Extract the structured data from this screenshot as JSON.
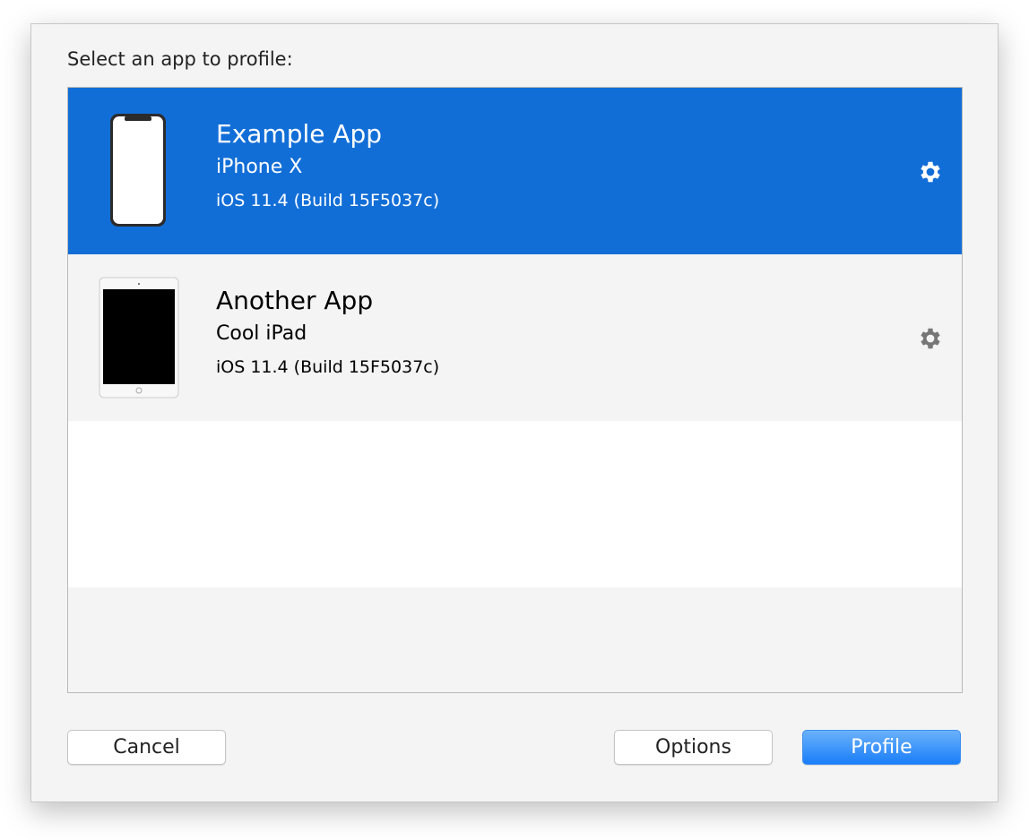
{
  "prompt": "Select an app to profile:",
  "apps": [
    {
      "name": "Example App",
      "device": "iPhone X",
      "os": "iOS 11.4 (Build 15F5037c)",
      "selected": true,
      "icon": "iphone-x-icon"
    },
    {
      "name": "Another App",
      "device": "Cool iPad",
      "os": "iOS 11.4 (Build 15F5037c)",
      "selected": false,
      "icon": "ipad-icon"
    }
  ],
  "buttons": {
    "cancel": "Cancel",
    "options": "Options",
    "profile": "Profile"
  },
  "colors": {
    "selection": "#126ed7",
    "primary_button": "#1a7ef8"
  }
}
